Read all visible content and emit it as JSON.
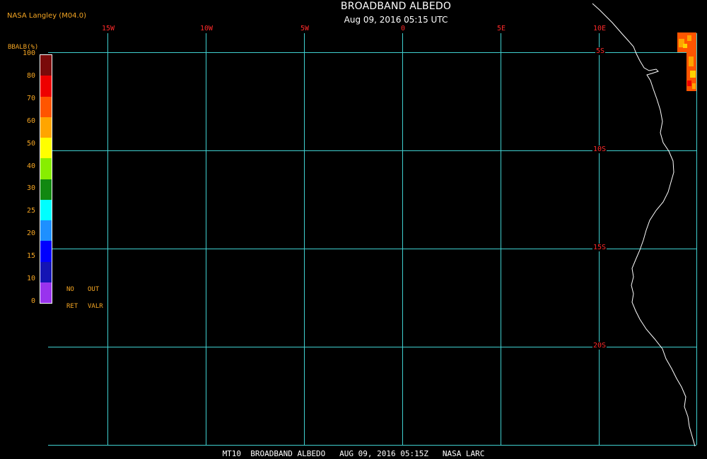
{
  "credit": "NASA Langley (M04.0)",
  "title": "BROADBAND ALBEDO",
  "subtitle": "Aug 09, 2016 05:15 UTC",
  "longitude_labels": [
    "15W",
    "10W",
    "5W",
    "0",
    "5E",
    "10E"
  ],
  "latitude_labels": [
    "5S",
    "10S",
    "15S",
    "20S"
  ],
  "colorbar": {
    "title": "BBALB(%)",
    "labels": [
      "100",
      "80",
      "70",
      "60",
      "50",
      "40",
      "30",
      "25",
      "20",
      "15",
      "10",
      "0"
    ],
    "colors": [
      "#7a0a0a",
      "#ee0000",
      "#ff5500",
      "#ffa500",
      "#ffff00",
      "#88ee00",
      "#118811",
      "#00ffff",
      "#1e90ff",
      "#0000ff",
      "#1414b4",
      "#9933ee"
    ],
    "no_ret": [
      "NO",
      "RET"
    ],
    "out_valr": [
      "OUT",
      "VALR"
    ]
  },
  "footer": "MT10  BROADBAND ALBEDO   AUG 09, 2016 05:15Z   NASA LARC",
  "colors": {
    "grid": "#40d0d0",
    "coast": "#ffffff",
    "label": "#ff2a2a",
    "accent": "#f5a623"
  },
  "map_region": {
    "lon_range": [
      "17W",
      "12E"
    ],
    "lat_range": [
      "3S",
      "25S"
    ]
  }
}
